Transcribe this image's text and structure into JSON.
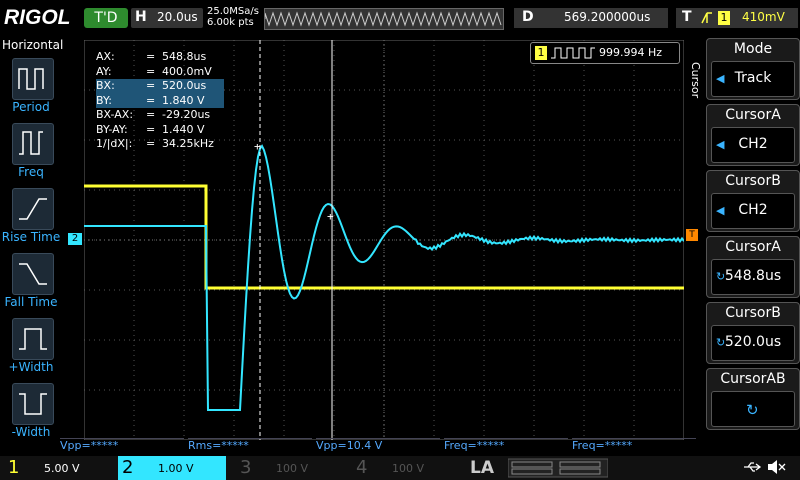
{
  "top": {
    "logo": "RIGOL",
    "trigger_status": "T'D",
    "h_label": "H",
    "timebase": "20.0us",
    "sample_rate": "25.0MSa/s",
    "mem_depth": "6.00k pts",
    "d_label": "D",
    "delay": "569.200000us",
    "t_label": "T",
    "trigger_level": "410mV"
  },
  "left": {
    "title": "Horizontal",
    "items": [
      {
        "label": "Period"
      },
      {
        "label": "Freq"
      },
      {
        "label": "Rise Time"
      },
      {
        "label": "Fall Time"
      },
      {
        "label": "+Width"
      },
      {
        "label": "-Width"
      }
    ]
  },
  "freq_counter": {
    "channel": "1",
    "value": "999.994 Hz"
  },
  "cursor_info": [
    {
      "label": "AX:",
      "eq": "=",
      "value": "548.8us",
      "hl": false
    },
    {
      "label": "AY:",
      "eq": "=",
      "value": "400.0mV",
      "hl": false
    },
    {
      "label": "BX:",
      "eq": "=",
      "value": "520.0us",
      "hl": true
    },
    {
      "label": "BY:",
      "eq": "=",
      "value": "1.840 V",
      "hl": true
    },
    {
      "label": "BX-AX:",
      "eq": "=",
      "value": "-29.20us",
      "hl": false
    },
    {
      "label": "BY-AY:",
      "eq": "=",
      "value": "1.440 V",
      "hl": false
    },
    {
      "label": "1/|dX|:",
      "eq": "=",
      "value": "34.25kHz",
      "hl": false
    }
  ],
  "measurements": [
    {
      "text": "Vpp=*****"
    },
    {
      "text": "Rms=*****"
    },
    {
      "text": "Vpp=10.4 V"
    },
    {
      "text": "Freq=*****"
    },
    {
      "text": "Freq=*****"
    }
  ],
  "channels": [
    {
      "num": "1",
      "value": "5.00 V",
      "color": "#ffff33"
    },
    {
      "num": "2",
      "value": "1.00 V",
      "color": "#33e6ff"
    },
    {
      "num": "3",
      "value": "100 V",
      "color": "#555555"
    },
    {
      "num": "4",
      "value": "100 V",
      "color": "#555555"
    }
  ],
  "la_label": "LA",
  "right": {
    "side_label": "Cursor",
    "boxes": [
      {
        "head": "Mode",
        "value": "Track"
      },
      {
        "head": "CursorA",
        "value": "CH2"
      },
      {
        "head": "CursorB",
        "value": "CH2"
      },
      {
        "head": "CursorA",
        "value": "548.8us"
      },
      {
        "head": "CursorB",
        "value": "520.0us"
      },
      {
        "head": "CursorAB",
        "value": ""
      }
    ]
  },
  "markers": {
    "ch2": "2",
    "trig": "T"
  },
  "colors": {
    "ch1": "#ffff33",
    "ch2": "#33e6ff",
    "accent": "#3ab4ff"
  }
}
